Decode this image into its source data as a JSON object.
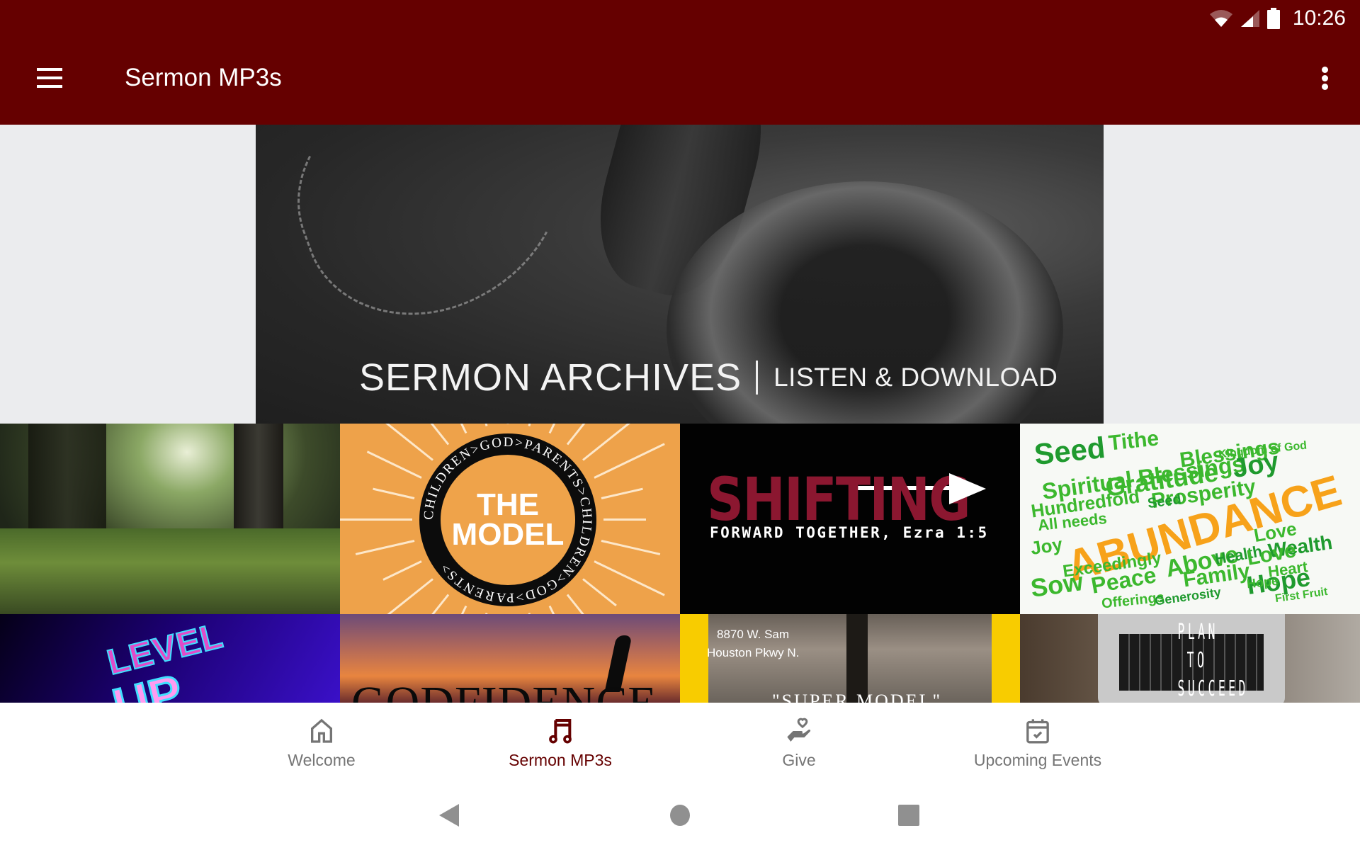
{
  "status_bar": {
    "time": "10:26",
    "icons": [
      "wifi-icon",
      "cell-signal-icon",
      "battery-icon"
    ]
  },
  "app_bar": {
    "title": "Sermon MP3s",
    "menu_icon": "hamburger-menu-icon",
    "overflow_icon": "more-vert-icon",
    "color": "#650000"
  },
  "banner": {
    "title": "SERMON ARCHIVES",
    "subtitle": "LISTEN & DOWNLOAD"
  },
  "sermon_series": [
    {
      "name": "forest",
      "text": ""
    },
    {
      "name": "the-model",
      "title_line1": "THE",
      "title_line2": "MODEL",
      "ring_text": "CHILDREN>GOD>PARENTS>CHILDREN>GOD>PARENTS>"
    },
    {
      "name": "shifting",
      "title": "SHIFTING",
      "subtitle": "FORWARD TOGETHER,  Ezra 1:5"
    },
    {
      "name": "abundance",
      "words": [
        "Seed",
        "Tithe",
        "Spiritual Blessings",
        "Blessings",
        "Joy",
        "Gratitude",
        "Prosperity",
        "Hundredfold",
        "Seed",
        "All needs",
        "ABUNDANCE",
        "Love",
        "Wealth",
        "Joy",
        "Exceedingly",
        "Above",
        "Health",
        "Love",
        "Peace",
        "Family",
        "Hope",
        "Heart",
        "Sow",
        "Offerings",
        "Generosity",
        "First Fruit",
        "Kingdom of God",
        "Hope"
      ]
    },
    {
      "name": "level-up",
      "title_line1": "LEVEL",
      "title_line2": "UP"
    },
    {
      "name": "godfidence",
      "title": "GODFIDENCE"
    },
    {
      "name": "super-model",
      "address_line1": "8870 W. Sam",
      "address_line2": "Houston Pkwy N.",
      "title": "\"SUPER MODEL\""
    },
    {
      "name": "plan-to-succeed",
      "line1": "PLAN",
      "line2": "TO",
      "line3": "SUCCEED"
    }
  ],
  "bottom_nav": {
    "active_color": "#650000",
    "inactive_color": "#757575",
    "items": [
      {
        "label": "Welcome",
        "icon": "home-icon",
        "active": false
      },
      {
        "label": "Sermon MP3s",
        "icon": "music-note-icon",
        "active": true
      },
      {
        "label": "Give",
        "icon": "give-heart-hand-icon",
        "active": false
      },
      {
        "label": "Upcoming Events",
        "icon": "calendar-check-icon",
        "active": false
      }
    ]
  },
  "system_nav": {
    "buttons": [
      "back-icon",
      "home-circle-icon",
      "recents-icon"
    ]
  }
}
